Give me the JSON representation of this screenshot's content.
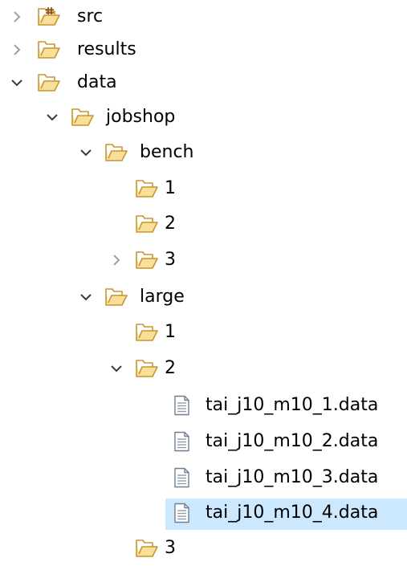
{
  "explorer": {
    "items": [
      {
        "label": "src"
      },
      {
        "label": "results"
      },
      {
        "label": "data"
      },
      {
        "label": "jobshop"
      },
      {
        "label": "bench"
      },
      {
        "label": "1"
      },
      {
        "label": "2"
      },
      {
        "label": "3"
      },
      {
        "label": "large"
      },
      {
        "label": "1"
      },
      {
        "label": "2"
      },
      {
        "label": "tai_j10_m10_1.data"
      },
      {
        "label": "tai_j10_m10_2.data"
      },
      {
        "label": "tai_j10_m10_3.data"
      },
      {
        "label": "tai_j10_m10_4.data"
      },
      {
        "label": "3"
      }
    ]
  },
  "colors": {
    "selection": "#cce8ff",
    "folder_fill": "#f8df9a",
    "folder_stroke": "#c8962d",
    "twisty_collapsed": "#a0a0a0",
    "twisty_expanded": "#3a3a3a"
  }
}
